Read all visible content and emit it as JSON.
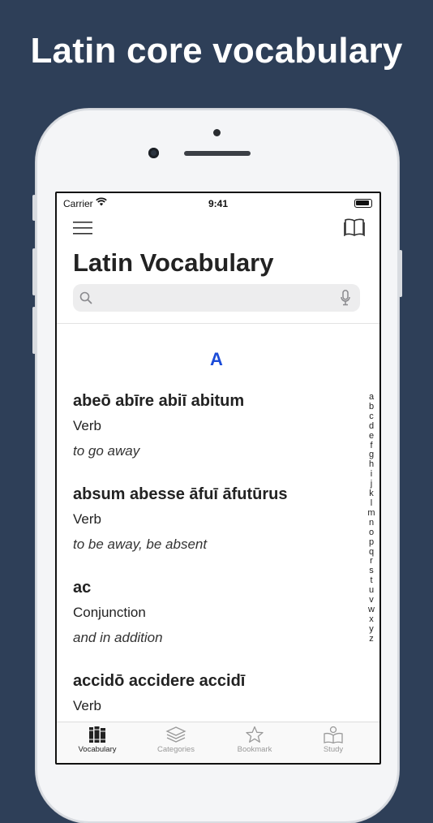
{
  "headline": "Latin core vocabulary",
  "status_bar": {
    "carrier": "Carrier",
    "time": "9:41"
  },
  "header": {
    "title": "Latin Vocabulary"
  },
  "search": {
    "placeholder": ""
  },
  "section_letter": "A",
  "entries": [
    {
      "term": "abeō abīre abiī abitum",
      "pos": "Verb",
      "meaning": "to go away"
    },
    {
      "term": "absum abesse āfuī āfutūrus",
      "pos": "Verb",
      "meaning": "to be away, be absent"
    },
    {
      "term": "ac",
      "pos": "Conjunction",
      "meaning": "and in addition"
    },
    {
      "term": "accidō accidere accidī",
      "pos": "Verb",
      "meaning": ""
    }
  ],
  "alphabet_index": [
    "a",
    "b",
    "c",
    "d",
    "e",
    "f",
    "g",
    "h",
    "i",
    "j",
    "k",
    "l",
    "m",
    "n",
    "o",
    "p",
    "q",
    "r",
    "s",
    "t",
    "u",
    "v",
    "w",
    "x",
    "y",
    "z"
  ],
  "tabs": [
    {
      "label": "Vocabulary",
      "icon": "books-icon",
      "active": true
    },
    {
      "label": "Categories",
      "icon": "stack-icon",
      "active": false
    },
    {
      "label": "Bookmark",
      "icon": "star-icon",
      "active": false
    },
    {
      "label": "Study",
      "icon": "study-icon",
      "active": false
    }
  ],
  "colors": {
    "background": "#2e3f58",
    "accent": "#1b4bd8"
  }
}
